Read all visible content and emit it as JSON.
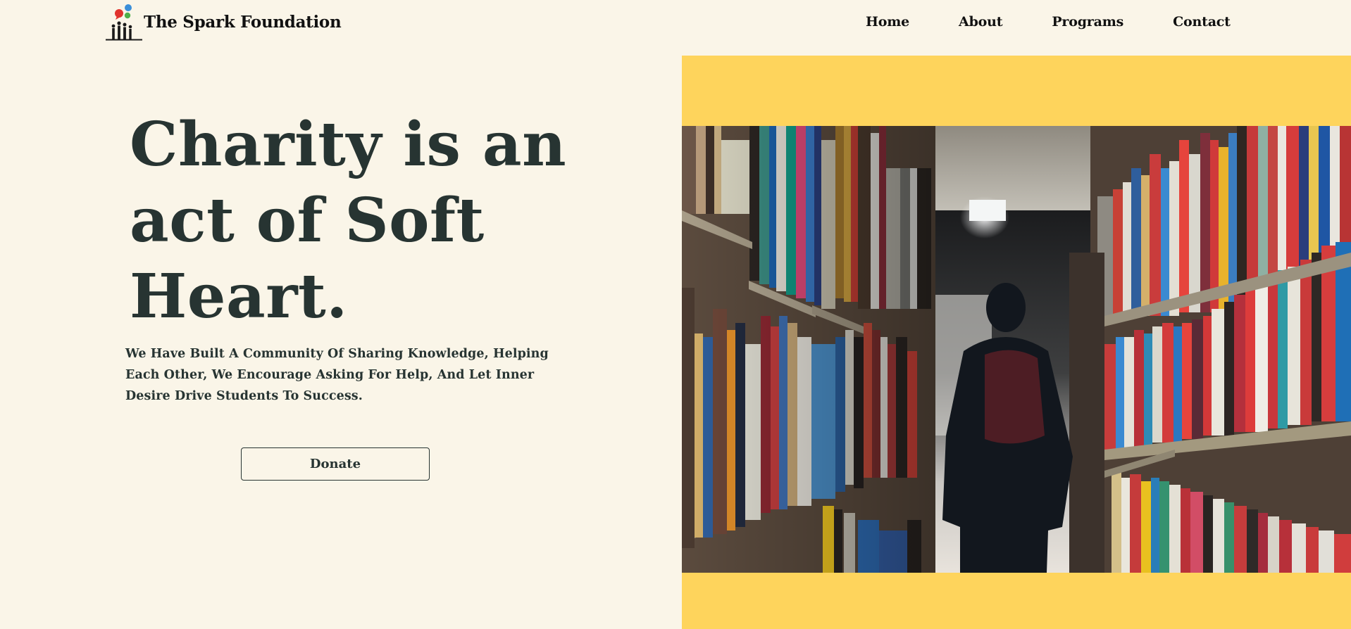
{
  "header": {
    "brand": "The Spark Foundation",
    "nav": [
      {
        "label": "Home"
      },
      {
        "label": "About"
      },
      {
        "label": "Programs"
      },
      {
        "label": "Contact"
      }
    ]
  },
  "hero": {
    "title_lines": [
      "Charity is an",
      "act of Soft",
      "Heart."
    ],
    "description": "We Have Built A Community Of Sharing Knowledge, Helping Each Other, We Encourage Asking For Help, And Let Inner Desire Drive Students To Success.",
    "donate_label": "Donate",
    "image_subject": "library-aisle-student-photo"
  },
  "colors": {
    "background": "#faf5e8",
    "text": "#273432",
    "accent_yellow": "#fed45c"
  },
  "icons": {
    "logo": "people-with-speech-bubbles-logo"
  }
}
